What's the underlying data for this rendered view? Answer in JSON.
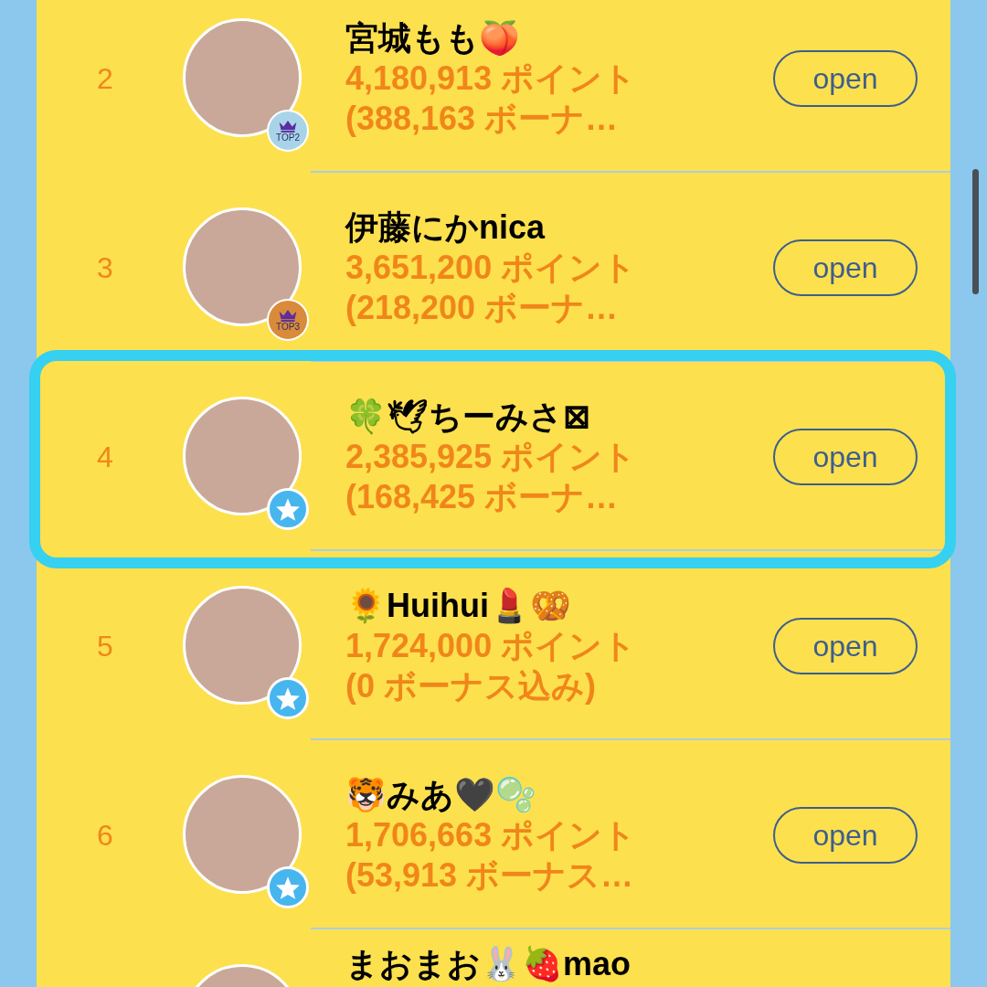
{
  "rows": [
    {
      "rank": "2",
      "name": "宮城もも🍑",
      "points": "4,180,913 ポイント",
      "bonus": "(388,163 ボーナ…",
      "badge": {
        "kind": "top",
        "label": "TOP2",
        "color": "#a9d4e8"
      },
      "button": "open",
      "selected": false
    },
    {
      "rank": "3",
      "name": "伊藤にかnica",
      "points": "3,651,200 ポイント",
      "bonus": "(218,200 ボーナ…",
      "badge": {
        "kind": "top",
        "label": "TOP3",
        "color": "#d98a3a"
      },
      "button": "open",
      "selected": false
    },
    {
      "rank": "4",
      "name": "🍀🕊ちーみさ⊠",
      "points": "2,385,925 ポイント",
      "bonus": "(168,425 ボーナ…",
      "badge": {
        "kind": "star"
      },
      "button": "open",
      "selected": true
    },
    {
      "rank": "5",
      "name": "🌻Huihui💄🥨",
      "points": "1,724,000 ポイント",
      "bonus": "(0 ボーナス込み)",
      "badge": {
        "kind": "star"
      },
      "button": "open",
      "selected": false
    },
    {
      "rank": "6",
      "name": "🐯みあ🖤🫧",
      "points": "1,706,663 ポイント",
      "bonus": "(53,913 ボーナス…",
      "badge": {
        "kind": "star"
      },
      "button": "open",
      "selected": false
    },
    {
      "name": "まおまお🐰🍓mao",
      "selected": false
    }
  ]
}
